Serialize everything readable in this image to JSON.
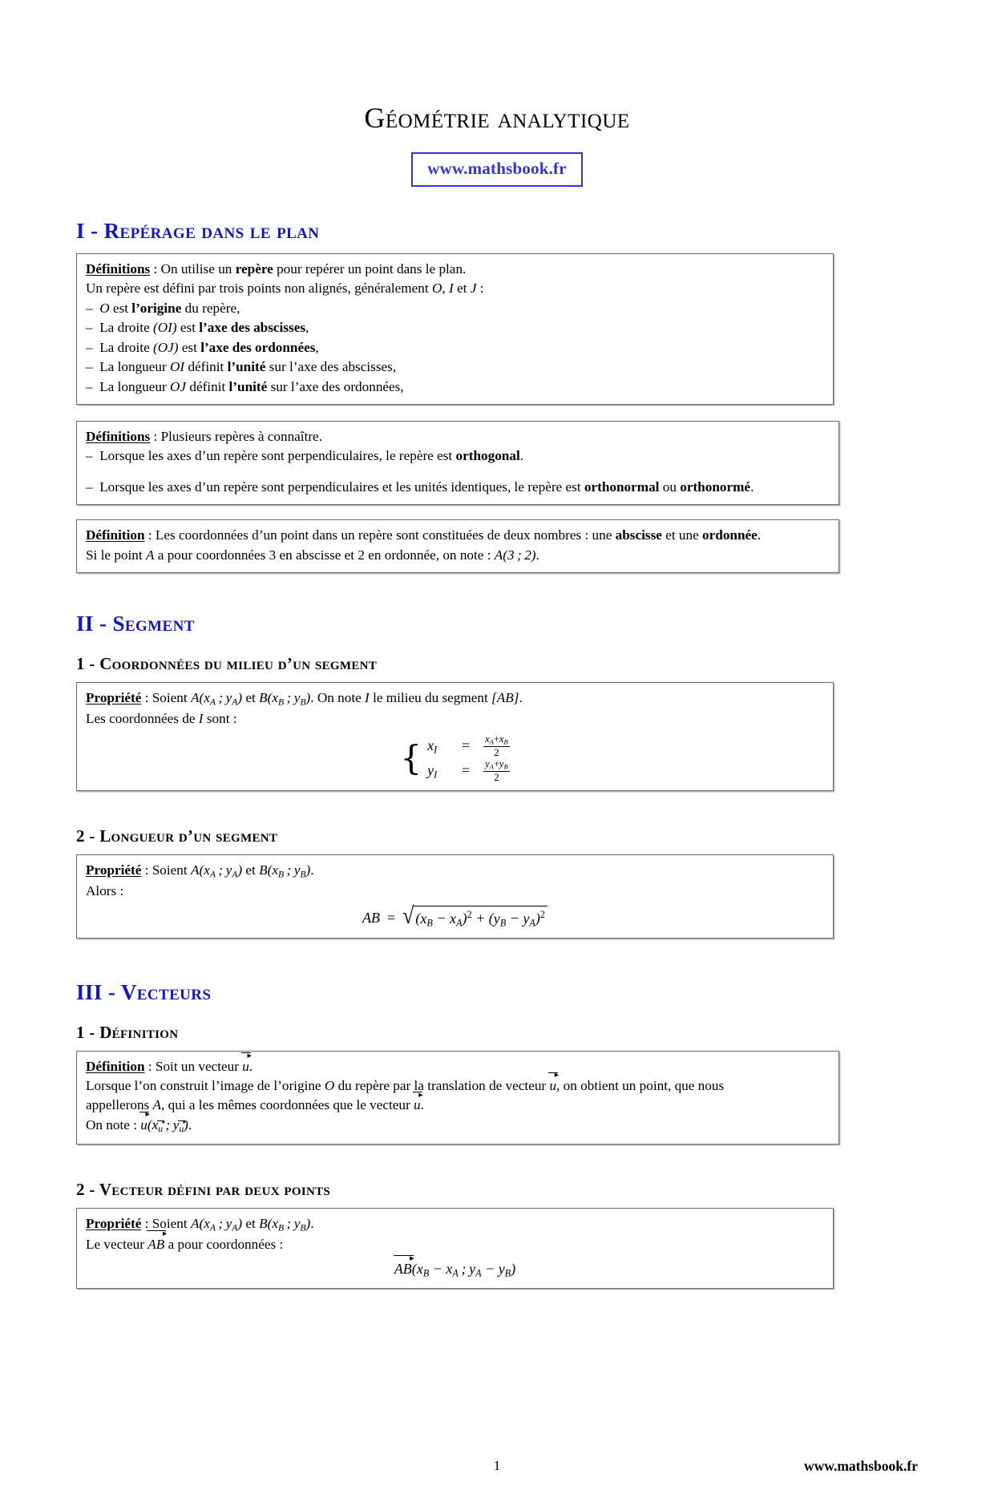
{
  "document": {
    "title": "Géométrie analytique",
    "site_url": "www.mathsbook.fr",
    "page_number": "1",
    "footer_url": "www.mathsbook.fr",
    "accent_color": "#1414CC",
    "url_box_color": "#3333DD"
  },
  "sections": [
    {
      "number": "I - ",
      "heading": "Repérage dans le plan",
      "boxes": [
        {
          "label": "Définitions",
          "intro": " : On utilise un ",
          "intro_bold": "repère",
          "intro_rest": " pour repérer un point dans le plan.",
          "line2_a": "Un repère est défini par trois points non alignés, généralement ",
          "line2_O": "O",
          "line2_sep1": ", ",
          "line2_I": "I",
          "line2_sep2": " et ",
          "line2_J": "J",
          "line2_end": " :",
          "items": [
            {
              "pre": "",
              "math1": "O",
              "mid": " est ",
              "bold": "l’origine",
              "post": " du repère,"
            },
            {
              "pre": "La droite ",
              "math1": "(OI)",
              "mid": " est ",
              "bold": "l’axe des abscisses",
              "post": ","
            },
            {
              "pre": "La droite ",
              "math1": "(OJ)",
              "mid": " est ",
              "bold": "l’axe des ordonnées",
              "post": ","
            },
            {
              "pre": "La longueur ",
              "math1": "OI",
              "mid": " définit ",
              "bold": "l’unité",
              "post": " sur l’axe des abscisses,"
            },
            {
              "pre": "La longueur ",
              "math1": "OJ",
              "mid": " définit ",
              "bold": "l’unité",
              "post": " sur l’axe des ordonnées,"
            }
          ]
        },
        {
          "label": "Définitions",
          "intro": " : Plusieurs repères à connaître.",
          "item1_pre": "Lorsque les axes d’un repère sont perpendiculaires, le repère est ",
          "item1_bold": "orthogonal",
          "item1_post": ".",
          "item2_pre": "Lorsque les axes d’un repère sont perpendiculaires et les unités identiques, le repère est ",
          "item2_bold1": "orthonormal",
          "item2_mid": " ou ",
          "item2_bold2": "orthonormé",
          "item2_post": "."
        },
        {
          "label": "Définition",
          "line1_pre": " : Les coordonnées d’un point dans un repère sont constituées de deux nombres : une ",
          "line1_bold1": "abscisse",
          "line1_mid": " et une ",
          "line1_bold2": "ordonnée",
          "line1_post": ".",
          "line2_pre": "Si le point ",
          "line2_A": "A",
          "line2_mid": " a pour coordonnées 3 en abscisse et 2 en ordonnée, on note : ",
          "line2_math": "A(3 ; 2)",
          "line2_post": "."
        }
      ]
    },
    {
      "number": "II - ",
      "heading": "Segment",
      "subsections": [
        {
          "number": "1 - ",
          "heading": "Coordonnées du milieu d’un segment",
          "box": {
            "label": "Propriété",
            "line1_pre": " : Soient ",
            "point_A": "A(xA ; yA)",
            "line1_mid": " et ",
            "point_B": "B(xB ; yB)",
            "line1_mid2": ". On note ",
            "point_I": "I",
            "line1_post": " le milieu du segment ",
            "segment": "[AB]",
            "line1_end": ".",
            "line2_pre": "Les coordonnées de ",
            "line2_I": "I",
            "line2_post": " sont :",
            "system": {
              "row1_lhs": "xI",
              "row1_eq": "=",
              "row1_num": "xA + xB",
              "row1_den": "2",
              "row2_lhs": "yI",
              "row2_eq": "=",
              "row2_num": "yA + yB",
              "row2_den": "2"
            }
          }
        },
        {
          "number": "2 - ",
          "heading": "Longueur d’un segment",
          "box": {
            "label": "Propriété",
            "line1_pre": " : Soient ",
            "point_A": "A(xA ; yA)",
            "line1_mid": " et ",
            "point_B": "B(xB ; yB)",
            "line1_end": ".",
            "line2": "Alors :",
            "formula": {
              "lhs": "AB",
              "eq": "=",
              "radicand_1": "(xB − xA)",
              "exp_1": "2",
              "plus": "+",
              "radicand_2": "(yB − yA)",
              "exp_2": "2"
            }
          }
        }
      ]
    },
    {
      "number": "III - ",
      "heading": "Vecteurs",
      "subsections": [
        {
          "number": "1 - ",
          "heading": "Définition",
          "box": {
            "label": "Définition",
            "line1_pre": " : Soit un vecteur ",
            "vec_u": "u",
            "line1_post": ".",
            "line2_pre": "Lorsque l’on construit l’image de l’origine ",
            "line2_O": "O",
            "line2_mid": " du repère par la translation de vecteur ",
            "line2_vec": "u",
            "line2_post": ", on obtient un point, que nous",
            "line3_pre": "appellerons ",
            "line3_A": "A",
            "line3_mid": ", qui a les mêmes coordonnées que le vecteur ",
            "line3_vec": "u",
            "line3_post": ".",
            "line4_pre": "On note : ",
            "line4_vec": "u",
            "line4_coords": "(xu ; yu)",
            "line4_post": "."
          }
        },
        {
          "number": "2 - ",
          "heading": "Vecteur défini par deux points",
          "box": {
            "label": "Propriété",
            "line1_pre": " : Soient ",
            "point_A": "A(xA ; yA)",
            "line1_mid": " et ",
            "point_B": "B(xB ; yB)",
            "line1_end": ".",
            "line2_pre": "Le vecteur ",
            "line2_vec": "AB",
            "line2_post": " a pour coordonnées :",
            "formula_vec": "AB",
            "formula_coords": "(xB − xA ; yA − yB)"
          }
        }
      ]
    }
  ]
}
